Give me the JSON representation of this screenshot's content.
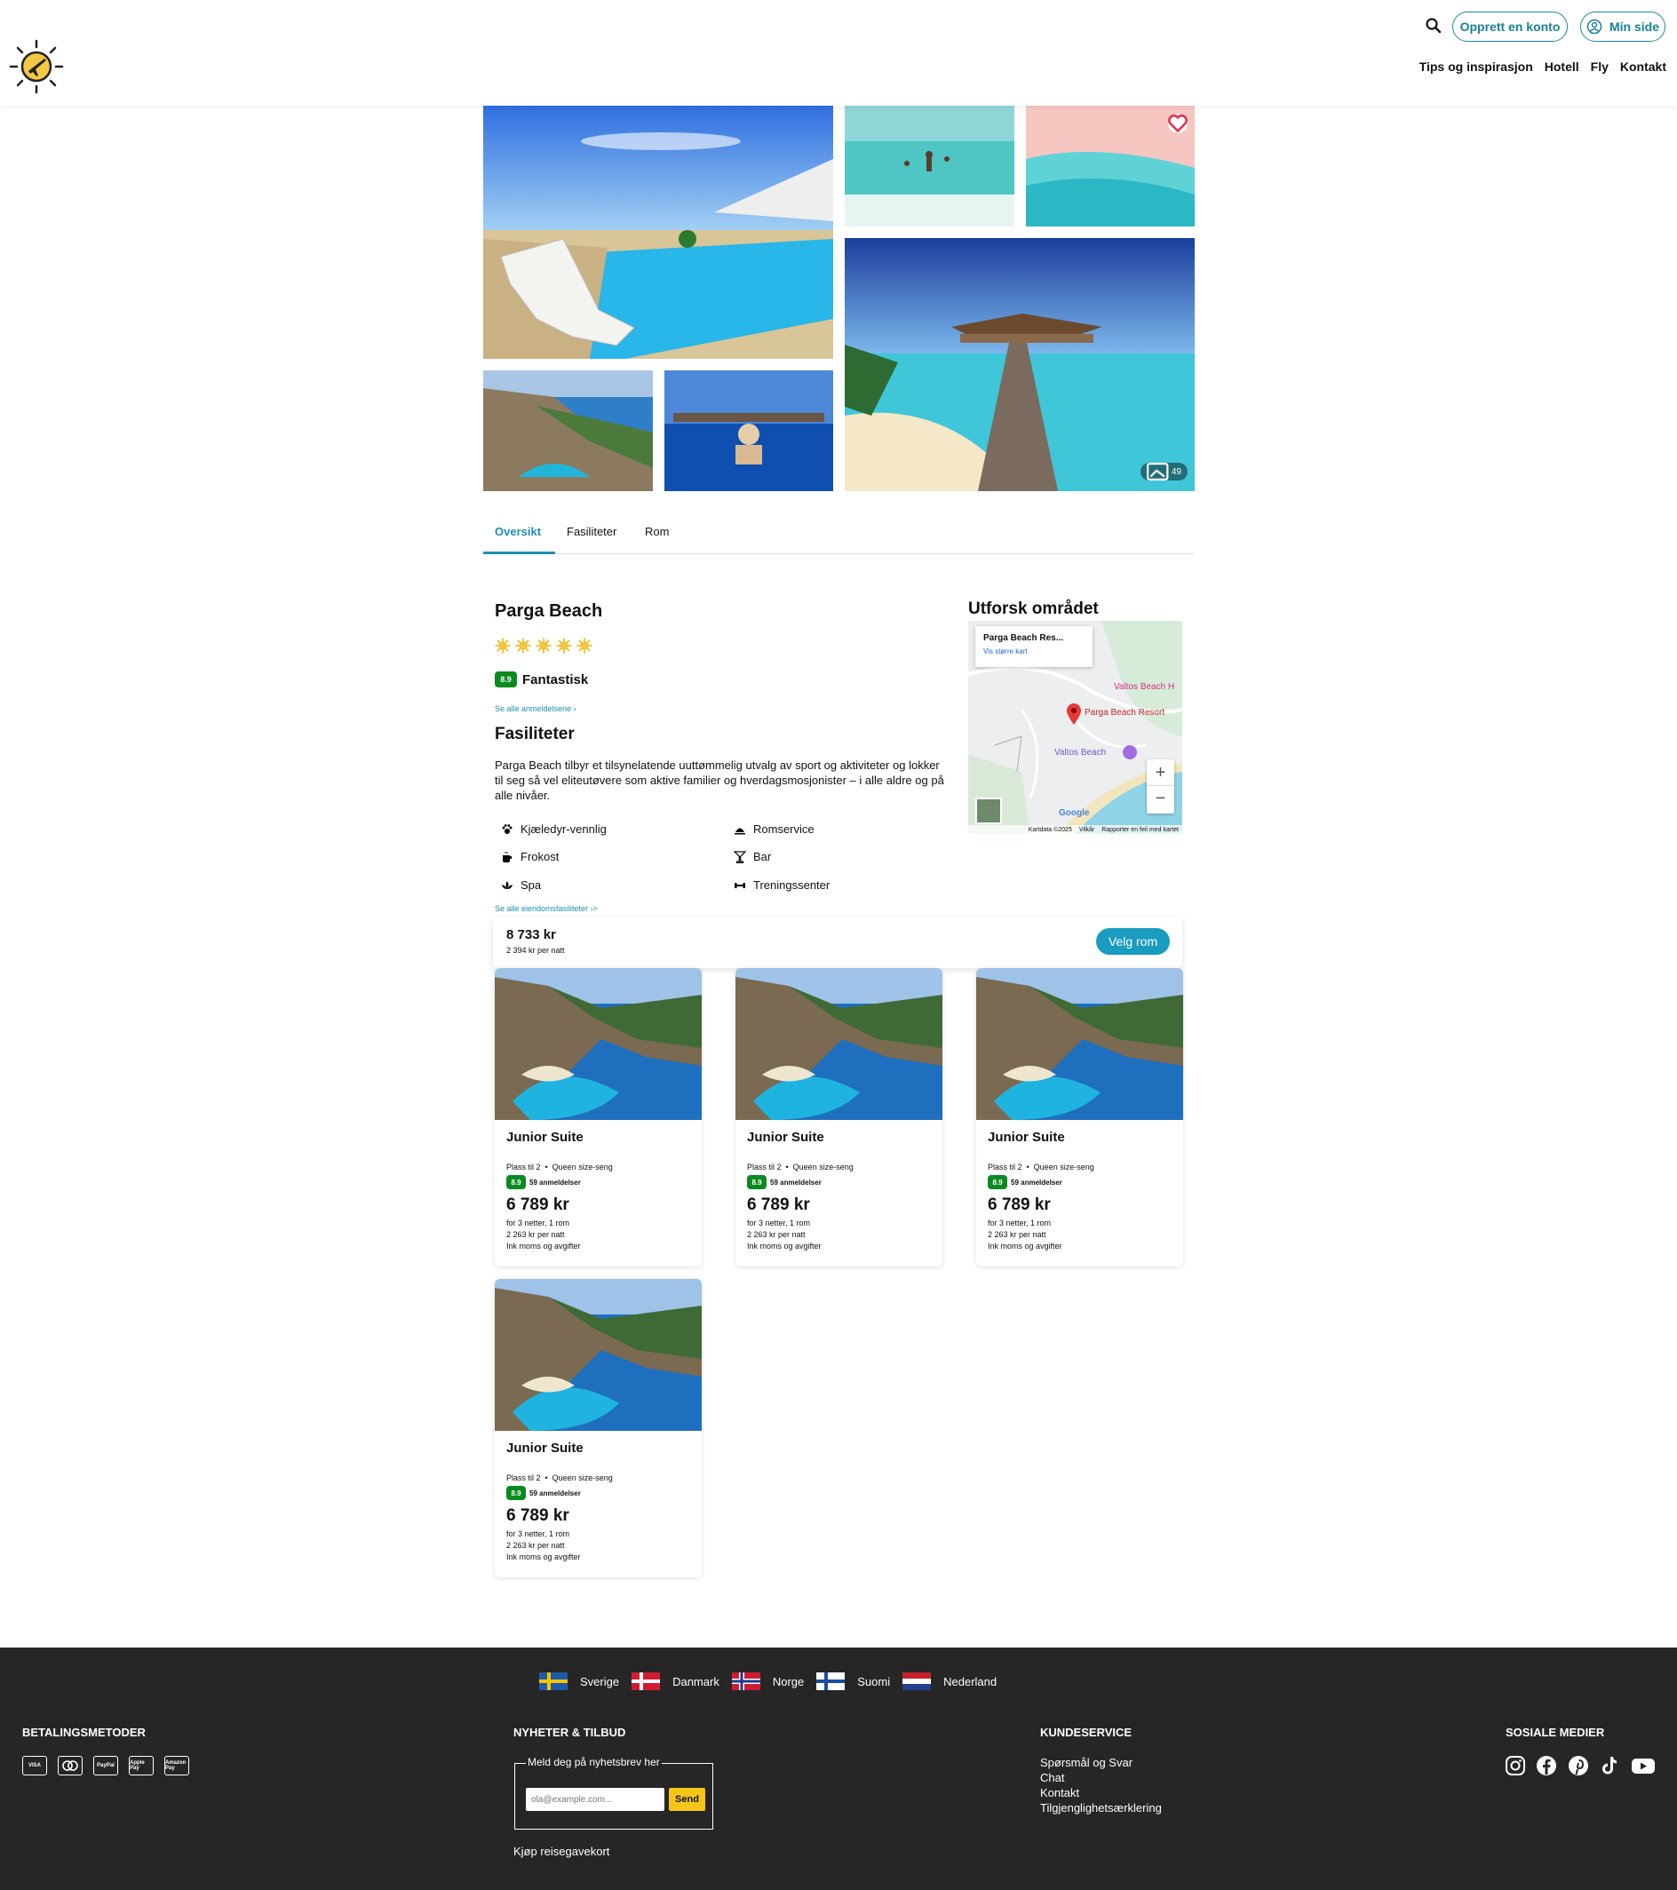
{
  "header": {
    "create_account": "Opprett en konto",
    "my_page": "Min side",
    "nav": [
      "Tips og inspirasjon",
      "Hotell",
      "Fly",
      "Kontakt"
    ]
  },
  "gallery": {
    "photo_count": "49"
  },
  "tabs": [
    "Oversikt",
    "Fasiliteter",
    "Rom"
  ],
  "hotel": {
    "name": "Parga Beach",
    "stars": 5,
    "rating": "8.9",
    "rating_label": "Fantastisk",
    "see_reviews": "Se alle anmeldelsene"
  },
  "facilities": {
    "heading": "Fasiliteter",
    "description": "Parga Beach tilbyr et tilsynelatende uuttømmelig utvalg av sport og aktiviteter og lokker til seg så vel eliteutøvere som aktive familier og hverdagsmosjonister – i alle aldre og på alle nivåer.",
    "items": [
      {
        "label": "Kjæledyr-vennlig",
        "icon": "paw-icon"
      },
      {
        "label": "Romservice",
        "icon": "cloche-icon"
      },
      {
        "label": "Frokost",
        "icon": "coffee-icon"
      },
      {
        "label": "Bar",
        "icon": "cocktail-icon"
      },
      {
        "label": "Spa",
        "icon": "lotus-icon"
      },
      {
        "label": "Treningssenter",
        "icon": "dumbbell-icon"
      }
    ],
    "see_all": "Se alle eiendomsfasiliteter"
  },
  "map": {
    "heading": "Utforsk området",
    "card_title": "Parga Beach Res...",
    "card_link": "Vis større kart",
    "pin_label": "Parga Beach Resort",
    "label_valtos_h": "Valtos Beach H",
    "label_valtos": "Valtos Beach",
    "google": "Google",
    "attrib": [
      "Kartdata ©2025",
      "Vilkår",
      "Rapporter en feil med kartet"
    ]
  },
  "pricebar": {
    "price": "8 733 kr",
    "per_night": "2 394 kr per natt",
    "button": "Velg rom"
  },
  "rooms": [
    {
      "title": "Junior Suite",
      "capacity": "Plass til 2",
      "bed": "Queen size-seng",
      "rating": "8.9",
      "reviews": "59 anmeldelser",
      "price": "6 789 kr",
      "stay": "for 3 netter, 1 rom",
      "per_night": "2 263 kr per natt",
      "tax": "Ink moms og avgifter"
    },
    {
      "title": "Junior Suite",
      "capacity": "Plass til 2",
      "bed": "Queen size-seng",
      "rating": "8.9",
      "reviews": "59 anmeldelser",
      "price": "6 789 kr",
      "stay": "for 3 netter, 1 rom",
      "per_night": "2 263 kr per natt",
      "tax": "Ink moms og avgifter"
    },
    {
      "title": "Junior Suite",
      "capacity": "Plass til 2",
      "bed": "Queen size-seng",
      "rating": "8.9",
      "reviews": "59 anmeldelser",
      "price": "6 789 kr",
      "stay": "for 3 netter, 1 rom",
      "per_night": "2 263 kr per natt",
      "tax": "Ink moms og avgifter"
    },
    {
      "title": "Junior Suite",
      "capacity": "Plass til 2",
      "bed": "Queen size-seng",
      "rating": "8.9",
      "reviews": "59 anmeldelser",
      "price": "6 789 kr",
      "stay": "for 3 netter, 1 rom",
      "per_night": "2 263 kr per natt",
      "tax": "Ink moms og avgifter"
    }
  ],
  "footer": {
    "countries": [
      "Sverige",
      "Danmark",
      "Norge",
      "Suomi",
      "Nederland"
    ],
    "payment_heading": "BETALINGSMETODER",
    "payment_methods": [
      "VISA",
      "Mastercard",
      "PayPal",
      "Apple Pay",
      "Amazon Pay"
    ],
    "newsletter_heading": "NYHETER & TILBUD",
    "newsletter_legend": "Meld deg på nyhetsbrev her",
    "email_placeholder": "ola@example.com...",
    "send": "Send",
    "gift_card": "Kjøp reisegavekort",
    "service_heading": "KUNDESERVICE",
    "service_links": [
      "Spørsmål og Svar",
      "Chat",
      "Kontakt",
      "Tilgjenglighetsærklering"
    ],
    "social_heading": "SOSIALE MEDIER",
    "social": [
      "instagram-icon",
      "facebook-icon",
      "pinterest-icon",
      "tiktok-icon",
      "youtube-icon"
    ]
  },
  "colors": {
    "accent": "#1e8fb0",
    "rating_green": "#0a8a1f",
    "footer_bg": "#262626",
    "send_yellow": "#f5c518"
  }
}
